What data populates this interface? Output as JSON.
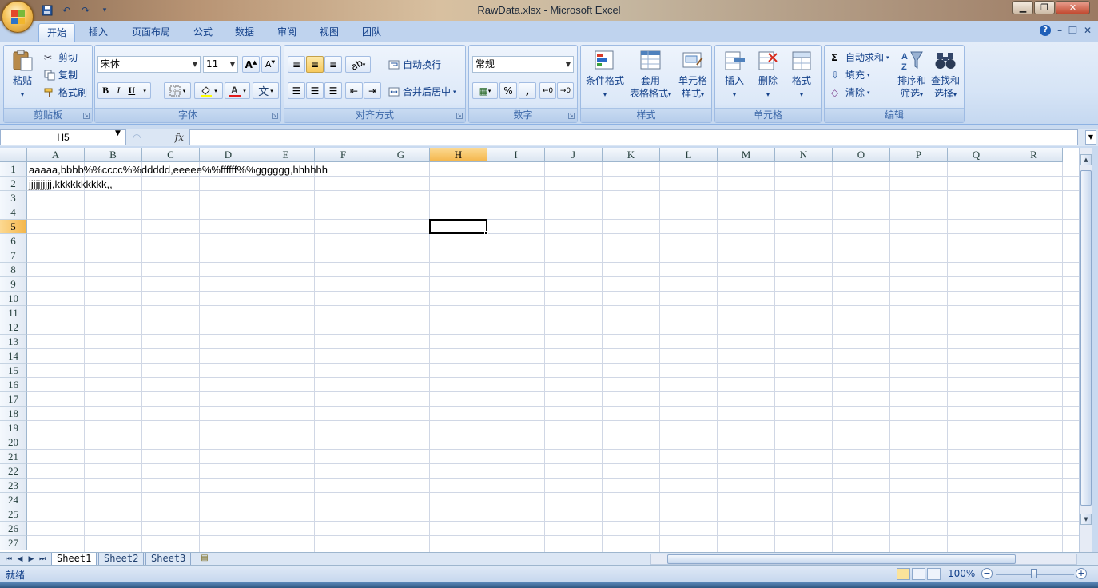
{
  "window": {
    "title": "RawData.xlsx - Microsoft Excel"
  },
  "tabs": [
    "开始",
    "插入",
    "页面布局",
    "公式",
    "数据",
    "审阅",
    "视图",
    "团队"
  ],
  "clipboard": {
    "label": "剪贴板",
    "paste": "粘贴",
    "cut": "剪切",
    "copy": "复制",
    "format_painter": "格式刷"
  },
  "font": {
    "label": "字体",
    "name": "宋体",
    "size": "11"
  },
  "alignment": {
    "label": "对齐方式",
    "wrap": "自动换行",
    "merge": "合并后居中"
  },
  "number": {
    "label": "数字",
    "format": "常规"
  },
  "styles": {
    "label": "样式",
    "conditional_1": "条件格式",
    "table_1": "套用",
    "table_2": "表格格式",
    "cell_1": "单元格",
    "cell_2": "样式"
  },
  "cells": {
    "label": "单元格",
    "insert": "插入",
    "delete": "删除",
    "format": "格式"
  },
  "editing": {
    "label": "编辑",
    "autosum": "自动求和",
    "fill": "填充",
    "clear": "清除",
    "sort_1": "排序和",
    "sort_2": "筛选",
    "find_1": "查找和",
    "find_2": "选择"
  },
  "name_box": "H5",
  "fx": "fx",
  "columns": [
    "A",
    "B",
    "C",
    "D",
    "E",
    "F",
    "G",
    "H",
    "I",
    "J",
    "K",
    "L",
    "M",
    "N",
    "O",
    "P",
    "Q",
    "R"
  ],
  "rows": [
    "1",
    "2",
    "3",
    "4",
    "5",
    "6",
    "7",
    "8",
    "9",
    "10",
    "11",
    "12",
    "13",
    "14",
    "15",
    "16",
    "17",
    "18",
    "19",
    "20",
    "21",
    "22",
    "23",
    "24",
    "25",
    "26",
    "27"
  ],
  "cells_data": {
    "A1": "aaaaa,bbbb%%cccc%%ddddd,eeeee%%ffffff%%gggggg,hhhhhh",
    "A2": "jjjjjjjjjj,kkkkkkkkkk,,"
  },
  "selected": {
    "col": "H",
    "row": "5"
  },
  "sheets": [
    "Sheet1",
    "Sheet2",
    "Sheet3"
  ],
  "active_sheet": "Sheet1",
  "status": {
    "text": "就绪",
    "zoom": "100%"
  }
}
